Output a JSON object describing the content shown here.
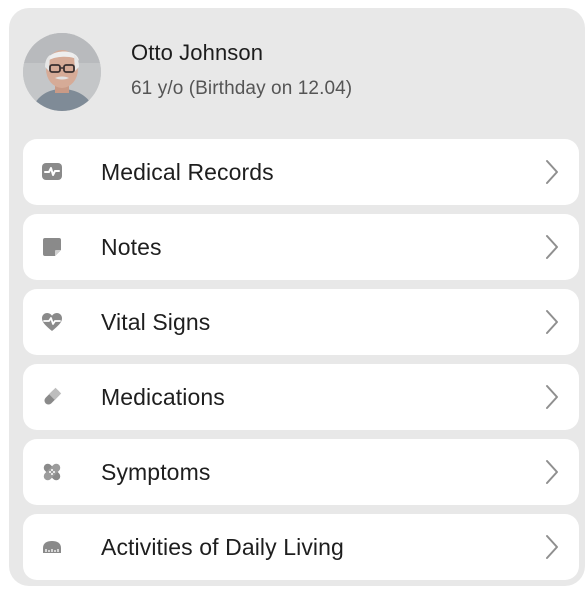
{
  "profile": {
    "name": "Otto Johnson",
    "age_text": "61 y/o (Birthday on 12.04)"
  },
  "menu": [
    {
      "label": "Medical Records",
      "icon": "medical-record-icon"
    },
    {
      "label": "Notes",
      "icon": "note-icon"
    },
    {
      "label": "Vital Signs",
      "icon": "heart-pulse-icon"
    },
    {
      "label": "Medications",
      "icon": "pill-icon"
    },
    {
      "label": "Symptoms",
      "icon": "bandage-icon"
    },
    {
      "label": "Activities of Daily Living",
      "icon": "tape-measure-icon"
    }
  ],
  "colors": {
    "panel_bg": "#e8e8e8",
    "card_bg": "#ffffff",
    "icon_gray": "#8a8a8a",
    "chevron_gray": "#8f8f8f"
  }
}
